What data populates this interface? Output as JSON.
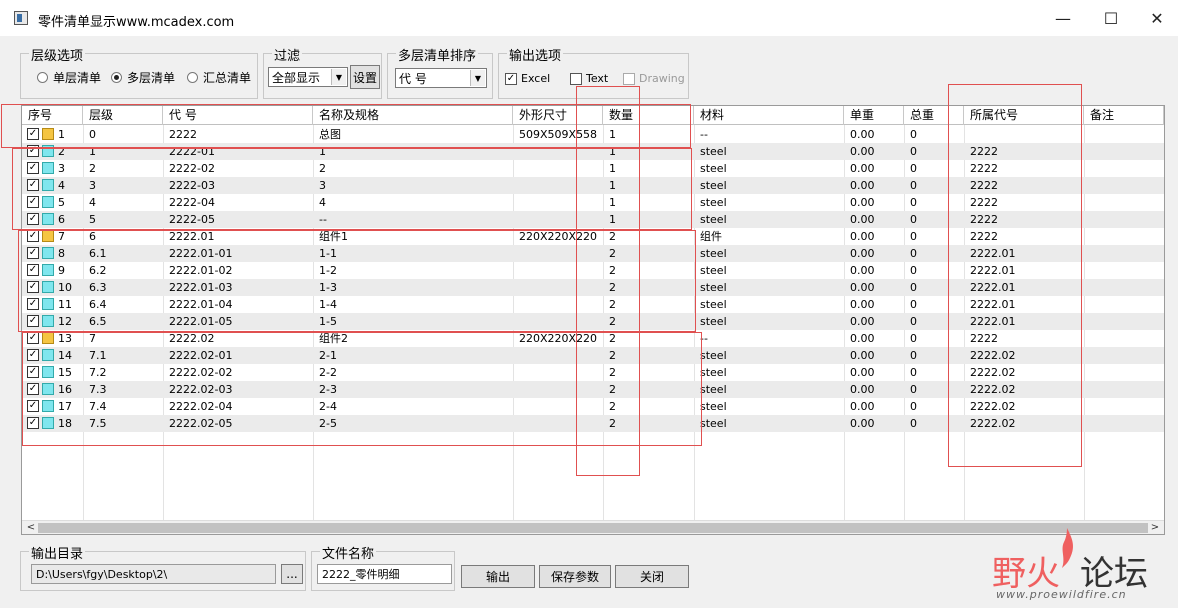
{
  "window": {
    "title": "零件清单显示www.mcadex.com",
    "controls": [
      "—",
      "☐",
      "✕"
    ]
  },
  "level_group": {
    "label": "层级选项",
    "options": [
      "单层清单",
      "多层清单",
      "汇总清单"
    ],
    "selected": "多层清单"
  },
  "filter_group": {
    "label": "过滤",
    "value": "全部显示",
    "settings_button": "设置"
  },
  "sort_group": {
    "label": "多层清单排序",
    "value": "代 号"
  },
  "output_options": {
    "label": "输出选项",
    "items": [
      {
        "label": "Excel",
        "checked": true,
        "enabled": true
      },
      {
        "label": "Text",
        "checked": false,
        "enabled": true
      },
      {
        "label": "Drawing",
        "checked": false,
        "enabled": false
      }
    ]
  },
  "table": {
    "headers": [
      "序号",
      "层级",
      "代 号",
      "名称及规格",
      "外形尺寸",
      "数量",
      "材料",
      "单重",
      "总重",
      "所属代号",
      "备注"
    ],
    "rows": [
      {
        "no": "1",
        "level": "0",
        "code": "2222",
        "name": "总图",
        "size": "509X509X558",
        "qty": "1",
        "material": "--",
        "unit_wt": "0.00",
        "total_wt": "0",
        "parent": "",
        "note": "",
        "type": "asm"
      },
      {
        "no": "2",
        "level": "1",
        "code": "2222-01",
        "name": "1",
        "size": "",
        "qty": "1",
        "material": "steel",
        "unit_wt": "0.00",
        "total_wt": "0",
        "parent": "2222",
        "note": "",
        "type": "part"
      },
      {
        "no": "3",
        "level": "2",
        "code": "2222-02",
        "name": "2",
        "size": "",
        "qty": "1",
        "material": "steel",
        "unit_wt": "0.00",
        "total_wt": "0",
        "parent": "2222",
        "note": "",
        "type": "part"
      },
      {
        "no": "4",
        "level": "3",
        "code": "2222-03",
        "name": "3",
        "size": "",
        "qty": "1",
        "material": "steel",
        "unit_wt": "0.00",
        "total_wt": "0",
        "parent": "2222",
        "note": "",
        "type": "part"
      },
      {
        "no": "5",
        "level": "4",
        "code": "2222-04",
        "name": "4",
        "size": "",
        "qty": "1",
        "material": "steel",
        "unit_wt": "0.00",
        "total_wt": "0",
        "parent": "2222",
        "note": "",
        "type": "part"
      },
      {
        "no": "6",
        "level": "5",
        "code": "2222-05",
        "name": "--",
        "size": "",
        "qty": "1",
        "material": "steel",
        "unit_wt": "0.00",
        "total_wt": "0",
        "parent": "2222",
        "note": "",
        "type": "part"
      },
      {
        "no": "7",
        "level": "6",
        "code": "2222.01",
        "name": "组件1",
        "size": "220X220X220",
        "qty": "2",
        "material": "组件",
        "unit_wt": "0.00",
        "total_wt": "0",
        "parent": "2222",
        "note": "",
        "type": "asm"
      },
      {
        "no": "8",
        "level": "6.1",
        "code": "2222.01-01",
        "name": "1-1",
        "size": "",
        "qty": "2",
        "material": "steel",
        "unit_wt": "0.00",
        "total_wt": "0",
        "parent": "2222.01",
        "note": "",
        "type": "part"
      },
      {
        "no": "9",
        "level": "6.2",
        "code": "2222.01-02",
        "name": "1-2",
        "size": "",
        "qty": "2",
        "material": "steel",
        "unit_wt": "0.00",
        "total_wt": "0",
        "parent": "2222.01",
        "note": "",
        "type": "part"
      },
      {
        "no": "10",
        "level": "6.3",
        "code": "2222.01-03",
        "name": "1-3",
        "size": "",
        "qty": "2",
        "material": "steel",
        "unit_wt": "0.00",
        "total_wt": "0",
        "parent": "2222.01",
        "note": "",
        "type": "part"
      },
      {
        "no": "11",
        "level": "6.4",
        "code": "2222.01-04",
        "name": "1-4",
        "size": "",
        "qty": "2",
        "material": "steel",
        "unit_wt": "0.00",
        "total_wt": "0",
        "parent": "2222.01",
        "note": "",
        "type": "part"
      },
      {
        "no": "12",
        "level": "6.5",
        "code": "2222.01-05",
        "name": "1-5",
        "size": "",
        "qty": "2",
        "material": "steel",
        "unit_wt": "0.00",
        "total_wt": "0",
        "parent": "2222.01",
        "note": "",
        "type": "part"
      },
      {
        "no": "13",
        "level": "7",
        "code": "2222.02",
        "name": "组件2",
        "size": "220X220X220",
        "qty": "2",
        "material": "--",
        "unit_wt": "0.00",
        "total_wt": "0",
        "parent": "2222",
        "note": "",
        "type": "asm"
      },
      {
        "no": "14",
        "level": "7.1",
        "code": "2222.02-01",
        "name": "2-1",
        "size": "",
        "qty": "2",
        "material": "steel",
        "unit_wt": "0.00",
        "total_wt": "0",
        "parent": "2222.02",
        "note": "",
        "type": "part"
      },
      {
        "no": "15",
        "level": "7.2",
        "code": "2222.02-02",
        "name": "2-2",
        "size": "",
        "qty": "2",
        "material": "steel",
        "unit_wt": "0.00",
        "total_wt": "0",
        "parent": "2222.02",
        "note": "",
        "type": "part"
      },
      {
        "no": "16",
        "level": "7.3",
        "code": "2222.02-03",
        "name": "2-3",
        "size": "",
        "qty": "2",
        "material": "steel",
        "unit_wt": "0.00",
        "total_wt": "0",
        "parent": "2222.02",
        "note": "",
        "type": "part"
      },
      {
        "no": "17",
        "level": "7.4",
        "code": "2222.02-04",
        "name": "2-4",
        "size": "",
        "qty": "2",
        "material": "steel",
        "unit_wt": "0.00",
        "total_wt": "0",
        "parent": "2222.02",
        "note": "",
        "type": "part"
      },
      {
        "no": "18",
        "level": "7.5",
        "code": "2222.02-05",
        "name": "2-5",
        "size": "",
        "qty": "2",
        "material": "steel",
        "unit_wt": "0.00",
        "total_wt": "0",
        "parent": "2222.02",
        "note": "",
        "type": "part"
      }
    ]
  },
  "footer": {
    "output_dir_label": "输出目录",
    "output_dir_value": "D:\\Users\\fgy\\Desktop\\2\\",
    "browse_button": "...",
    "file_name_label": "文件名称",
    "file_name_value": "2222_零件明细",
    "buttons": [
      "输出",
      "保存参数",
      "关闭"
    ]
  },
  "watermark": {
    "brand_red": "野火",
    "brand_dark": "论坛",
    "url": "www.proewildfire.cn"
  },
  "colors": {
    "highlight_box": "#e05050",
    "part_icon": "#7fe6ee",
    "assembly_icon": "#f5c542"
  }
}
